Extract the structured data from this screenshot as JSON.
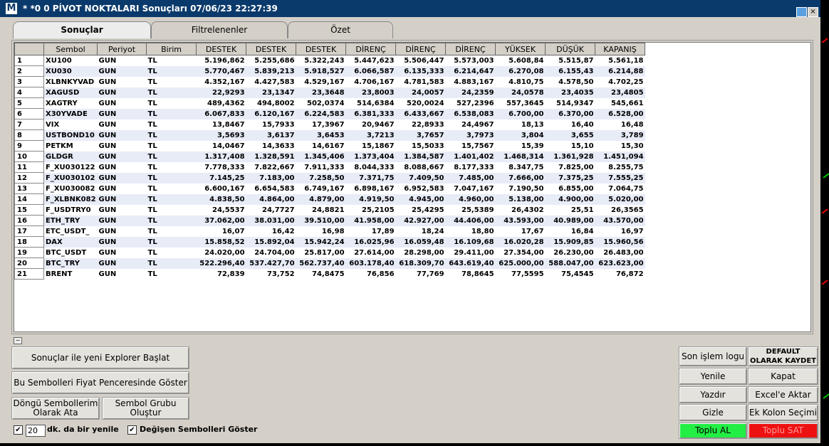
{
  "window": {
    "logo": "M",
    "title": "* *0  0 PİVOT NOKTALARI Sonuçları  07/06/23 22:27:39"
  },
  "tabs": [
    "Sonuçlar",
    "Filtrelenenler",
    "Özet"
  ],
  "columns": [
    "",
    "Sembol",
    "Periyot",
    "Birim",
    "DESTEK",
    "DESTEK",
    "DESTEK",
    "DİRENÇ",
    "DİRENÇ",
    "DİRENÇ",
    "YÜKSEK",
    "DÜŞÜK",
    "KAPANIŞ"
  ],
  "rows": [
    [
      "1",
      "XU100",
      "GUN",
      "TL",
      "5.196,862",
      "5.255,686",
      "5.322,243",
      "5.447,623",
      "5.506,447",
      "5.573,003",
      "5.608,84",
      "5.515,87",
      "5.561,18"
    ],
    [
      "2",
      "XU030",
      "GUN",
      "TL",
      "5.770,467",
      "5.839,213",
      "5.918,527",
      "6.066,587",
      "6.135,333",
      "6.214,647",
      "6.270,08",
      "6.155,43",
      "6.214,88"
    ],
    [
      "3",
      "XLBNKYVAD",
      "GUN",
      "TL",
      "4.352,167",
      "4.427,583",
      "4.529,167",
      "4.706,167",
      "4.781,583",
      "4.883,167",
      "4.810,75",
      "4.578,50",
      "4.702,25"
    ],
    [
      "4",
      "XAGUSD",
      "GUN",
      "TL",
      "22,9293",
      "23,1347",
      "23,3648",
      "23,8003",
      "24,0057",
      "24,2359",
      "24,0578",
      "23,4035",
      "23,4805"
    ],
    [
      "5",
      "XAGTRY",
      "GUN",
      "TL",
      "489,4362",
      "494,8002",
      "502,0374",
      "514,6384",
      "520,0024",
      "527,2396",
      "557,3645",
      "514,9347",
      "545,661"
    ],
    [
      "6",
      "X30YVADE",
      "GUN",
      "TL",
      "6.067,833",
      "6.120,167",
      "6.224,583",
      "6.381,333",
      "6.433,667",
      "6.538,083",
      "6.700,00",
      "6.370,00",
      "6.528,00"
    ],
    [
      "7",
      "VIX",
      "GUN",
      "TL",
      "13,8467",
      "15,7933",
      "17,3967",
      "20,9467",
      "22,8933",
      "24,4967",
      "18,13",
      "16,40",
      "16,48"
    ],
    [
      "8",
      "USTBOND10",
      "GUN",
      "TL",
      "3,5693",
      "3,6137",
      "3,6453",
      "3,7213",
      "3,7657",
      "3,7973",
      "3,804",
      "3,655",
      "3,789"
    ],
    [
      "9",
      "PETKM",
      "GUN",
      "TL",
      "14,0467",
      "14,3633",
      "14,6167",
      "15,1867",
      "15,5033",
      "15,7567",
      "15,39",
      "15,10",
      "15,30"
    ],
    [
      "10",
      "GLDGR",
      "GUN",
      "TL",
      "1.317,408",
      "1.328,591",
      "1.345,406",
      "1.373,404",
      "1.384,587",
      "1.401,402",
      "1.468,314",
      "1.361,928",
      "1.451,094"
    ],
    [
      "11",
      "F_XU030122",
      "GUN",
      "TL",
      "7.778,333",
      "7.822,667",
      "7.911,333",
      "8.044,333",
      "8.088,667",
      "8.177,333",
      "8.347,75",
      "7.825,00",
      "8.255,75"
    ],
    [
      "12",
      "F_XU030102",
      "GUN",
      "TL",
      "7.145,25",
      "7.183,00",
      "7.258,50",
      "7.371,75",
      "7.409,50",
      "7.485,00",
      "7.666,00",
      "7.375,25",
      "7.555,25"
    ],
    [
      "13",
      "F_XU030082",
      "GUN",
      "TL",
      "6.600,167",
      "6.654,583",
      "6.749,167",
      "6.898,167",
      "6.952,583",
      "7.047,167",
      "7.190,50",
      "6.855,00",
      "7.064,75"
    ],
    [
      "14",
      "F_XLBNK082",
      "GUN",
      "TL",
      "4.838,50",
      "4.864,00",
      "4.879,00",
      "4.919,50",
      "4.945,00",
      "4.960,00",
      "5.138,00",
      "4.900,00",
      "5.020,00"
    ],
    [
      "15",
      "F_USDTRY0",
      "GUN",
      "TL",
      "24,5537",
      "24,7727",
      "24,8821",
      "25,2105",
      "25,4295",
      "25,5389",
      "26,4302",
      "25,51",
      "26,3565"
    ],
    [
      "16",
      "ETH_TRY",
      "GUN",
      "TL",
      "37.062,00",
      "38.031,00",
      "39.510,00",
      "41.958,00",
      "42.927,00",
      "44.406,00",
      "43.593,00",
      "40.989,00",
      "43.570,00"
    ],
    [
      "17",
      "ETC_USDT_",
      "GUN",
      "TL",
      "16,07",
      "16,42",
      "16,98",
      "17,89",
      "18,24",
      "18,80",
      "17,67",
      "16,84",
      "16,97"
    ],
    [
      "18",
      "DAX",
      "GUN",
      "TL",
      "15.858,52",
      "15.892,04",
      "15.942,24",
      "16.025,96",
      "16.059,48",
      "16.109,68",
      "16.020,28",
      "15.909,85",
      "15.960,56"
    ],
    [
      "19",
      "BTC_USDT",
      "GUN",
      "TL",
      "24.020,00",
      "24.704,00",
      "25.817,00",
      "27.614,00",
      "28.298,00",
      "29.411,00",
      "27.354,00",
      "26.230,00",
      "26.483,00"
    ],
    [
      "20",
      "BTC_TRY",
      "GUN",
      "TL",
      "522.296,40",
      "537.427,70",
      "562.737,40",
      "603.178,40",
      "618.309,70",
      "643.619,40",
      "625.000,00",
      "588.047,00",
      "623.623,00"
    ],
    [
      "21",
      "BRENT",
      "GUN",
      "TL",
      "72,839",
      "73,752",
      "74,8475",
      "76,856",
      "77,769",
      "78,8645",
      "77,5595",
      "75,4545",
      "76,872"
    ]
  ],
  "buttons": {
    "explorer": "Sonuçlar ile yeni Explorer Başlat",
    "price_window": "Bu Sembolleri Fiyat Penceresinde Göster",
    "loop": "Döngü Sembollerim Olarak Ata",
    "group": "Sembol Grubu Oluştur",
    "last_log": "Son işlem logu",
    "default_save": "DEFAULT OLARAK KAYDET",
    "refresh": "Yenile",
    "close": "Kapat",
    "print": "Yazdır",
    "excel": "Excel'e Aktar",
    "hide": "Gizle",
    "extra_col": "Ek Kolon Seçimi",
    "buy": "Toplu AL",
    "sell": "Toplu SAT"
  },
  "refresh": {
    "minutes": "20",
    "label": "dk. da bir yenile",
    "changed_label": "Değişen Sembolleri Göster"
  },
  "colors": {
    "title_bg": "#0a3a6b",
    "buy": "#22ee44",
    "sell": "#ee1111"
  }
}
